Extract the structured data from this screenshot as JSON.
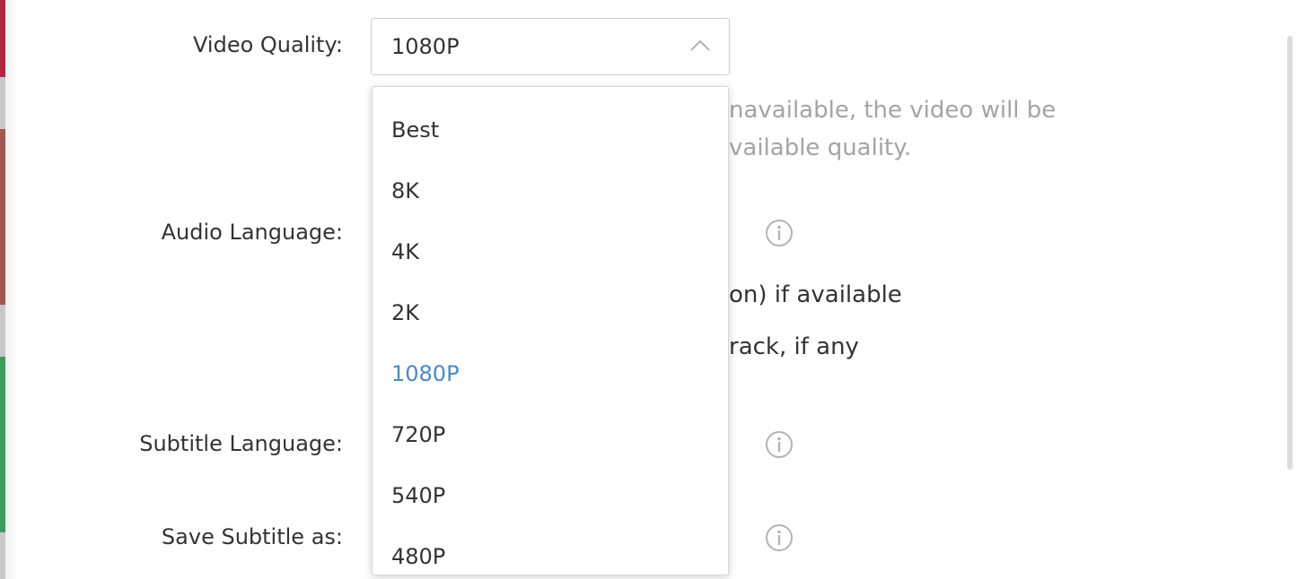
{
  "labels": {
    "video_quality": "Video Quality:",
    "audio_language": "Audio Language:",
    "subtitle_language": "Subtitle Language:",
    "save_subtitle_as": "Save Subtitle as:"
  },
  "video_quality": {
    "selected": "1080P",
    "options": [
      "Best",
      "8K",
      "4K",
      "2K",
      "1080P",
      "720P",
      "540P",
      "480P"
    ],
    "hint_line1": "navailable, the video will be",
    "hint_line2": "vailable quality."
  },
  "audio_options": {
    "option1_text": "on) if available",
    "option2_text": "rack, if any"
  },
  "colors": {
    "selected_option": "#4a8ac7",
    "hint_text": "#a4a4a4",
    "icon_gray": "#b4b4b4"
  }
}
